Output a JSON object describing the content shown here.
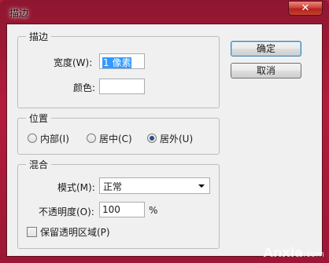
{
  "window": {
    "title": "描边",
    "close_symbol": "✕"
  },
  "stroke_group": {
    "legend": "描边",
    "width_label": "宽度(W):",
    "width_value": "1 像素",
    "color_label": "颜色:",
    "color_value": "#ffffff"
  },
  "position_group": {
    "legend": "位置",
    "options": [
      {
        "label": "内部(I)",
        "checked": false
      },
      {
        "label": "居中(C)",
        "checked": false
      },
      {
        "label": "居外(U)",
        "checked": true
      }
    ]
  },
  "blend_group": {
    "legend": "混合",
    "mode_label": "模式(M):",
    "mode_value": "正常",
    "opacity_label": "不透明度(O):",
    "opacity_value": "100",
    "opacity_unit": "%",
    "preserve_label": "保留透明区域(P)",
    "preserve_checked": false
  },
  "buttons": {
    "ok_label": "确定",
    "cancel_label": "取消"
  },
  "watermark": {
    "text": "Anxia",
    "domain": ".com"
  }
}
